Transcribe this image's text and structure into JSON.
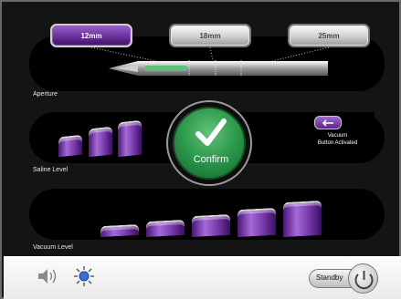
{
  "aperture": {
    "label": "Aperture",
    "sizes": [
      {
        "label": "12mm",
        "selected": true
      },
      {
        "label": "18mm",
        "selected": false
      },
      {
        "label": "25mm",
        "selected": false
      }
    ]
  },
  "saline": {
    "label": "Saline Level",
    "bars_total": 3,
    "bars_filled": 3
  },
  "vacuum": {
    "label": "Vacuum Level",
    "bars_total": 5,
    "bars_filled": 5,
    "indicator_text": "Vacuum\nButton Activated"
  },
  "confirm": {
    "label": "Confirm"
  },
  "footer": {
    "standby_label": "Standby"
  },
  "colors": {
    "accent_purple": "#6a2f9c",
    "confirm_green": "#2f9c4e",
    "background": "#141414"
  },
  "icons": {
    "volume": "speaker-icon",
    "brightness": "sun-icon",
    "power": "power-icon",
    "confirm": "checkmark-icon",
    "vacuum": "vacuum-icon"
  }
}
